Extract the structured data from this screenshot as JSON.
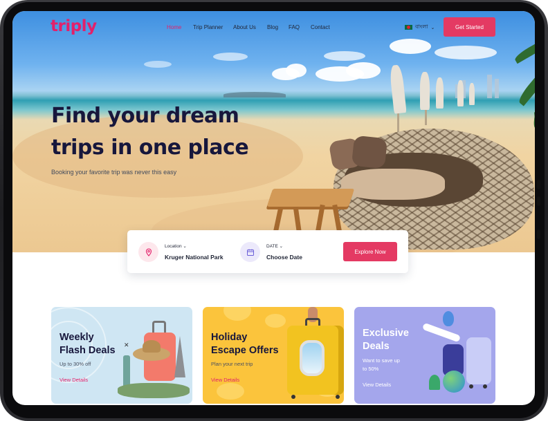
{
  "header": {
    "logo": "triply",
    "nav": [
      {
        "label": "Home",
        "active": true
      },
      {
        "label": "Trip Planner",
        "active": false
      },
      {
        "label": "About Us",
        "active": false
      },
      {
        "label": "Blog",
        "active": false
      },
      {
        "label": "FAQ",
        "active": false
      },
      {
        "label": "Contact",
        "active": false
      }
    ],
    "language": "বাংলা",
    "cta": "Get Started"
  },
  "hero": {
    "title_line1": "Find your dream",
    "title_line2": "trips in one place",
    "subtitle": "Booking your favorite trip was never this easy"
  },
  "search": {
    "location_label": "Location",
    "location_value": "Kruger National Park",
    "date_label": "DATE",
    "date_value": "Choose Date",
    "button": "Explore Now"
  },
  "cards": [
    {
      "title_line1": "Weekly",
      "title_line2": "Flash Deals",
      "subtitle": "Up to 30% off",
      "link": "View Details"
    },
    {
      "title_line1": "Holiday",
      "title_line2": "Escape Offers",
      "subtitle": "Plan your next trip",
      "link": "View Details"
    },
    {
      "title_line1": "Exclusive",
      "title_line2": "Deals",
      "subtitle_line1": "Want to save up",
      "subtitle_line2": "to 50%",
      "link": "View Details"
    }
  ],
  "colors": {
    "brand": "#e3206a",
    "button": "#e43a63",
    "heading": "#17173c",
    "card1": "#cfe6f3",
    "card2": "#fbc43c",
    "card3": "#a4a6ec"
  },
  "icons": [
    "location-pin-icon",
    "calendar-icon",
    "chevron-down-icon",
    "flag-icon"
  ]
}
